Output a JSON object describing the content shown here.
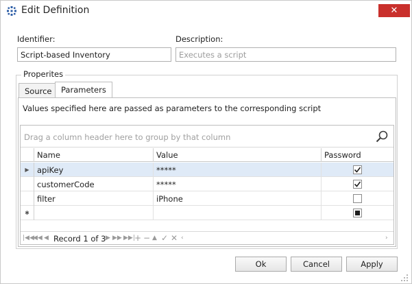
{
  "window": {
    "title": "Edit Definition",
    "close_glyph": "✕"
  },
  "form": {
    "identifier_label": "Identifier:",
    "identifier_value": "Script-based Inventory",
    "description_label": "Description:",
    "description_placeholder": "Executes a script"
  },
  "properties": {
    "title": "Properites",
    "tabs": [
      {
        "label": "Source",
        "active": false
      },
      {
        "label": "Parameters",
        "active": true
      }
    ],
    "description": "Values specified here are passed as parameters to the corresponding script"
  },
  "grid": {
    "group_hint": "Drag a column header here to group by that column",
    "columns": [
      "Name",
      "Value",
      "Password"
    ],
    "rows": [
      {
        "name": "apiKey",
        "value": "*****",
        "password": true,
        "focused": true
      },
      {
        "name": "customerCode",
        "value": "*****",
        "password": true,
        "focused": false
      },
      {
        "name": "filter",
        "value": "iPhone",
        "password": false,
        "focused": false
      }
    ],
    "new_row_glyph": "✱",
    "navigator": {
      "record_text": "Record 1 of 3"
    }
  },
  "buttons": {
    "ok": "Ok",
    "cancel": "Cancel",
    "apply": "Apply"
  },
  "colors": {
    "close_red": "#c9302c",
    "row_focus": "#dfeaf7",
    "app_icon_blue": "#2f5fa7"
  }
}
